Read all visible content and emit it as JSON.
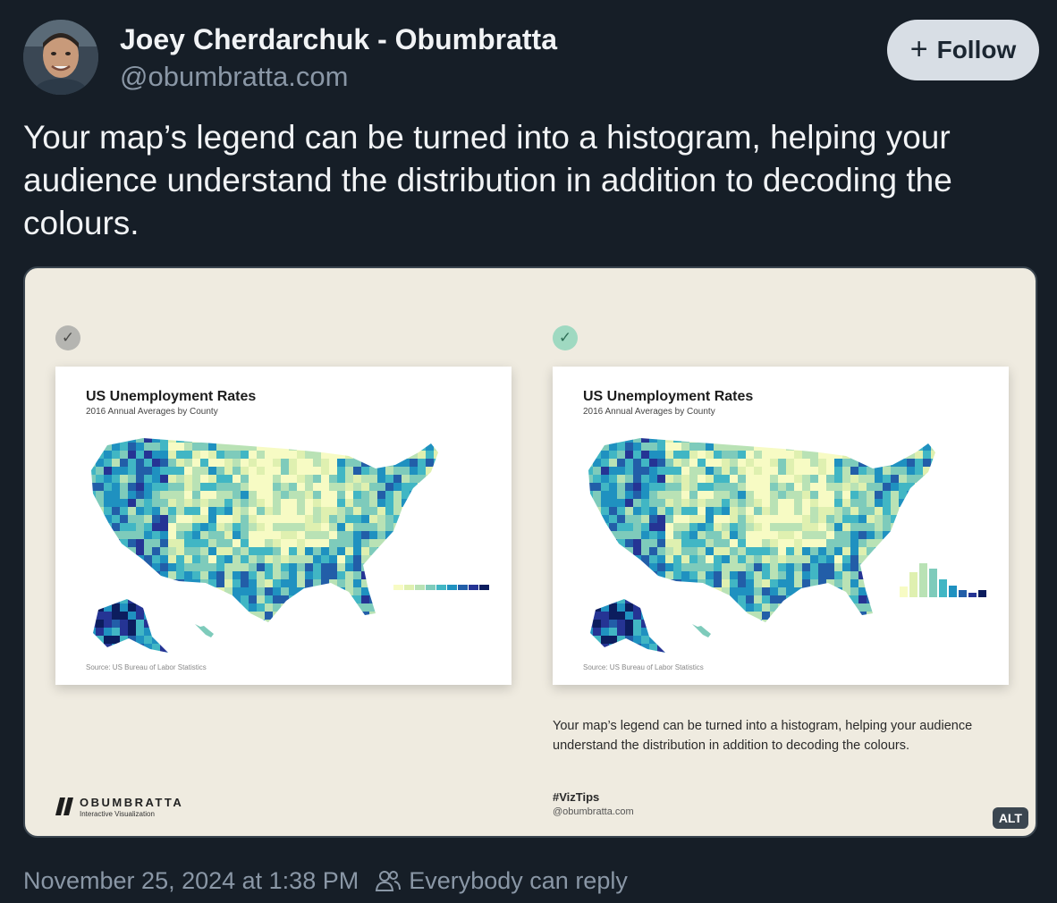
{
  "author": {
    "display_name": "Joey Cherdarchuk - Obumbratta",
    "handle": "@obumbratta.com",
    "avatar_icon": "person-avatar"
  },
  "follow_button": {
    "label": "Follow",
    "icon": "plus-icon"
  },
  "post": {
    "text": "Your map’s legend can be turned into a histogram, helping your audience understand the distribution in addition to decoding the colours."
  },
  "media": {
    "left_panel": {
      "badge": "check-icon",
      "map_title": "US Unemployment Rates",
      "map_subtitle": "2016 Annual Averages by County",
      "source": "Source: US Bureau of Labor Statistics"
    },
    "right_panel": {
      "badge": "check-icon",
      "map_title": "US Unemployment Rates",
      "map_subtitle": "2016 Annual Averages by County",
      "source": "Source: US Bureau of Labor Statistics"
    },
    "caption": "Your map’s legend can be turned into a histogram, helping your audience understand the distribution in addition to decoding the colours.",
    "hashtag": "#VizTips",
    "caption_handle": "@obumbratta.com",
    "brand_name": "OBUMBRATTA",
    "brand_tagline": "Interactive Visualization",
    "alt_label": "ALT"
  },
  "footer": {
    "timestamp": "November 25, 2024 at 1:38 PM",
    "reply_setting": "Everybody can reply",
    "reply_icon": "people-icon"
  },
  "colors": {
    "background": "#161e27",
    "card": "#efebe0",
    "follow_button": "#d8dee5",
    "palette": [
      "#f7fbc4",
      "#dff0b0",
      "#b9e2b5",
      "#7ecbbb",
      "#41b6c4",
      "#1f91c0",
      "#225ea8",
      "#253494",
      "#0c1d5e"
    ]
  }
}
